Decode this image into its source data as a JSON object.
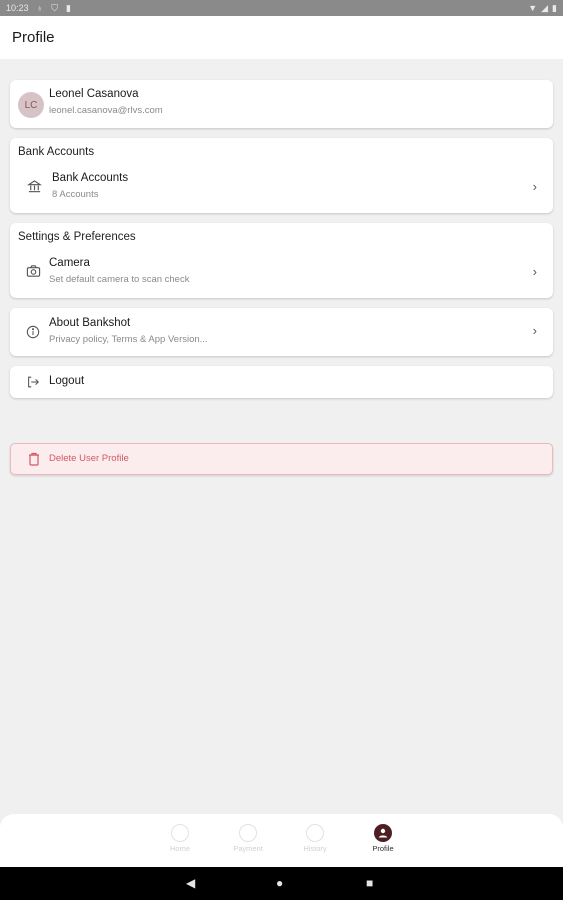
{
  "status_bar": {
    "time": "10:23"
  },
  "app_bar": {
    "title": "Profile"
  },
  "profile": {
    "initials": "LC",
    "name": "Leonel Casanova",
    "email": "leonel.casanova@rlvs.com"
  },
  "bank_section": {
    "title": "Bank Accounts",
    "item": {
      "title": "Bank Accounts",
      "subtitle": "8 Accounts",
      "icon": "bank-icon"
    }
  },
  "settings_section": {
    "title": "Settings & Preferences",
    "item": {
      "title": "Camera",
      "subtitle": "Set default camera to scan check",
      "icon": "camera-icon"
    }
  },
  "about": {
    "title": "About Bankshot",
    "subtitle": "Privacy policy, Terms & App Version...",
    "icon": "info-icon"
  },
  "logout": {
    "label": "Logout",
    "icon": "logout-icon"
  },
  "delete_profile": {
    "label": "Delete User Profile",
    "icon": "trash-icon"
  },
  "bottom_nav": {
    "items": [
      {
        "label": "Home",
        "icon": "home-icon",
        "active": false
      },
      {
        "label": "Payment",
        "icon": "payment-icon",
        "active": false
      },
      {
        "label": "History",
        "icon": "history-icon",
        "active": false
      },
      {
        "label": "Profile",
        "icon": "profile-icon",
        "active": true
      }
    ]
  },
  "colors": {
    "accent": "#4d1f24",
    "danger": "#d35a66",
    "danger_bg": "#fbeced",
    "background": "#f0f0f0"
  }
}
